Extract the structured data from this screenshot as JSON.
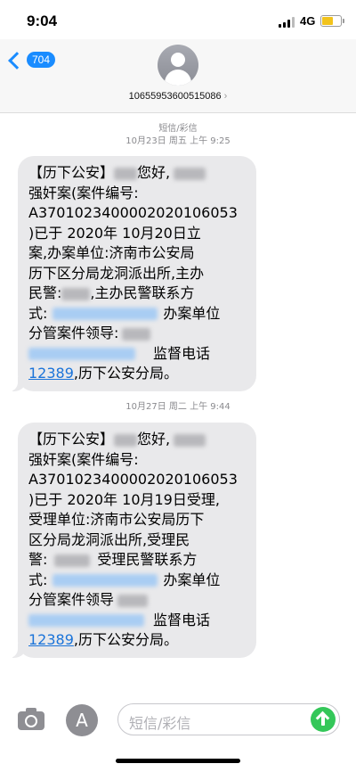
{
  "status_bar": {
    "time": "9:04",
    "network": "4G"
  },
  "header": {
    "back_count": "704",
    "phone_number": "10655953600515086",
    "chevron": "›"
  },
  "thread": {
    "label": "短信/彩信",
    "messages": [
      {
        "timestamp": "10月23日 周五 上午 9:25",
        "l1a": "【历下公安】",
        "l1b": "您好,",
        "l2": "强奸案(案件编号:",
        "l3": "A3701023400002020106053",
        "l4": ")已于 2020年 10月20日立",
        "l5": "案,办案单位:济南市公安局",
        "l6": "历下区分局龙洞派出所,主办",
        "l7a": "民警:",
        "l7b": ",主办民警联系方",
        "l8a": "式:",
        "l8b": "办案单位",
        "l9": "分管案件领导:",
        "l10": "监督电话",
        "l11_link": "12389",
        "l11b": ",历下公安分局。"
      },
      {
        "timestamp": "10月27日 周二 上午 9:44",
        "l1a": "【历下公安】",
        "l1b": "您好,",
        "l2": "强奸案(案件编号:",
        "l3": "A3701023400002020106053",
        "l4": ")已于 2020年 10月19日受理,",
        "l5": "受理单位:济南市公安局历下",
        "l6": "区分局龙洞派出所,受理民",
        "l7a": "警:",
        "l7b": "受理民警联系方",
        "l8a": "式:",
        "l8b": "办案单位",
        "l9": "分管案件领导",
        "l10": "监督电话",
        "l11_link": "12389",
        "l11b": ",历下公安分局。"
      }
    ]
  },
  "composer": {
    "placeholder": "短信/彩信",
    "apps_glyph": "A"
  },
  "colors": {
    "accent": "#1a8cff",
    "send": "#34c759",
    "bubble": "#e9e9eb",
    "battery": "#f2c31c"
  }
}
